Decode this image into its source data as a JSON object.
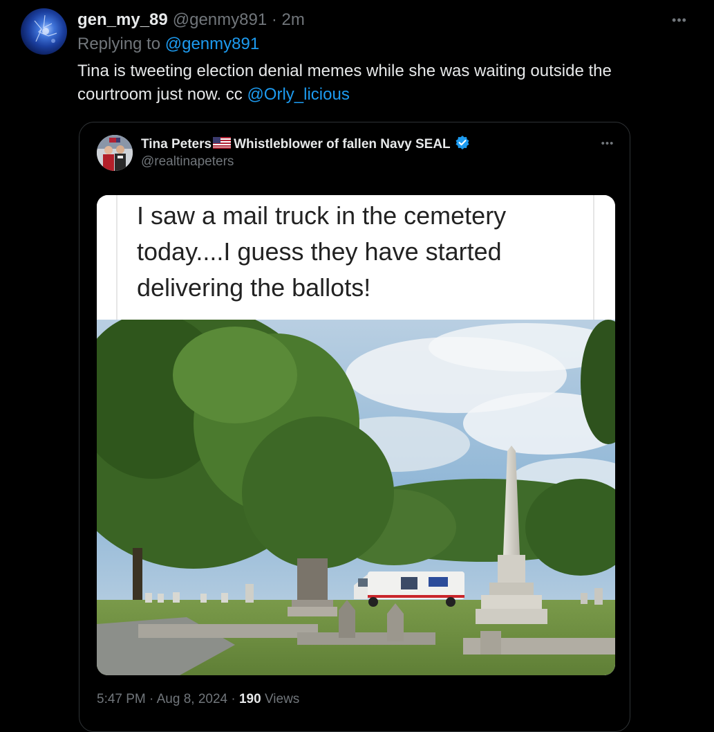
{
  "tweet": {
    "username": "gen_my_89",
    "handle": "@genmy891",
    "separator": "·",
    "time": "2m",
    "more_icon": "more-dots-icon",
    "reply_prefix": "Replying to",
    "reply_to": "@genmy891",
    "text": "Tina is tweeting election denial memes while she was waiting outside the courtroom just now. cc",
    "mention": "@Orly_licious"
  },
  "quote": {
    "name": "Tina Peters",
    "flag_icon": "us-flag-icon",
    "title": "Whistleblower of fallen Navy SEAL",
    "verified_icon": "verified-badge-icon",
    "handle": "@realtinapeters",
    "more_icon": "more-dots-icon",
    "meme_text": "I saw a mail truck in the cemetery today....I guess they have started delivering the ballots!",
    "time": "5:47 PM",
    "separator": "·",
    "date": "Aug 8, 2024",
    "views_count": "190",
    "views_label": "Views"
  },
  "colors": {
    "background": "#000000",
    "text_primary": "#e7e9ea",
    "text_secondary": "#71767b",
    "link": "#1d9bf0",
    "border": "#2f3336",
    "verified": "#1d9bf0"
  }
}
